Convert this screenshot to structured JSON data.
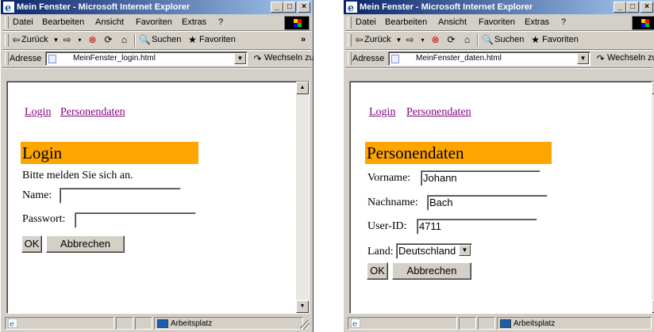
{
  "left_window": {
    "title": "Mein Fenster - Microsoft Internet Explorer",
    "menu": [
      "Datei",
      "Bearbeiten",
      "Ansicht",
      "Favoriten",
      "Extras",
      "?"
    ],
    "toolbar": {
      "back": "Zurück",
      "search": "Suchen",
      "favorites": "Favoriten",
      "more": "»"
    },
    "address": {
      "label": "Adresse",
      "url": "MeinFenster_login.html",
      "go": "Wechseln zu"
    },
    "page": {
      "links": [
        "Login",
        "Personendaten"
      ],
      "heading": "Login",
      "intro": "Bitte melden Sie sich an.",
      "name_label": "Name:",
      "name_value": "",
      "password_label": "Passwort:",
      "password_value": "",
      "ok_label": "OK",
      "cancel_label": "Abbrechen"
    },
    "status": {
      "zone": "Arbeitsplatz"
    }
  },
  "right_window": {
    "title": "Mein Fenster - Microsoft Internet Explorer",
    "menu": [
      "Datei",
      "Bearbeiten",
      "Ansicht",
      "Favoriten",
      "Extras",
      "?"
    ],
    "toolbar": {
      "back": "Zurück",
      "search": "Suchen",
      "favorites": "Favoriten"
    },
    "address": {
      "label": "Adresse",
      "url": "MeinFenster_daten.html",
      "go": "Wechseln zu"
    },
    "page": {
      "links": [
        "Login",
        "Personendaten"
      ],
      "heading": "Personendaten",
      "firstname_label": "Vorname:",
      "firstname_value": "Johann",
      "lastname_label": "Nachname:",
      "lastname_value": "Bach",
      "userid_label": "User-ID:",
      "userid_value": "4711",
      "country_label": "Land:",
      "country_value": "Deutschland",
      "ok_label": "OK",
      "cancel_label": "Abbrechen"
    },
    "status": {
      "zone": "Arbeitsplatz"
    }
  },
  "colors": {
    "heading_bg": "#ffa500",
    "titlebar_start": "#0a246a",
    "link_visited": "#800080"
  }
}
